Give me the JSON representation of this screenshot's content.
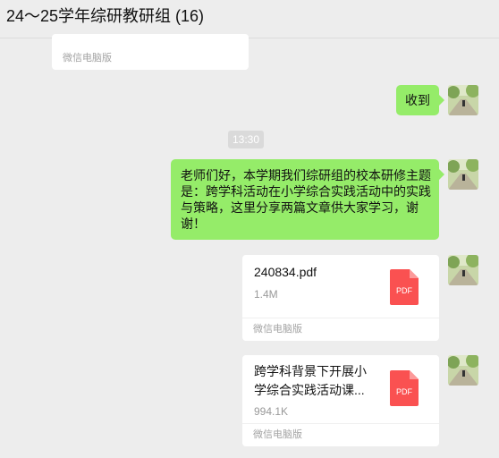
{
  "window": {
    "title": "24～25学年综研教研组 (16)"
  },
  "messages": {
    "top_card": {
      "source": "微信电脑版"
    },
    "reply": {
      "text": "收到"
    },
    "time": "13:30",
    "announcement": {
      "lines": [
        "老师们好，本学期我们综研组的校本研修主题",
        "是：跨学科活动在小学综合实践活动中的实践",
        "与策略，这里分享两篇文章供大家学习，谢",
        "谢！"
      ]
    },
    "file1": {
      "name": "240834.pdf",
      "size": "1.4M",
      "icon": "pdf-icon",
      "icon_label": "PDF",
      "source": "微信电脑版"
    },
    "file2": {
      "name_lines": [
        "跨学科背景下开展小",
        "学综合实践活动课..."
      ],
      "size": "994.1K",
      "icon": "pdf-icon",
      "icon_label": "PDF",
      "source": "微信电脑版"
    }
  },
  "colors": {
    "bubble_green": "#95ec69",
    "pdf_red": "#fa5151",
    "background": "#ededed"
  }
}
